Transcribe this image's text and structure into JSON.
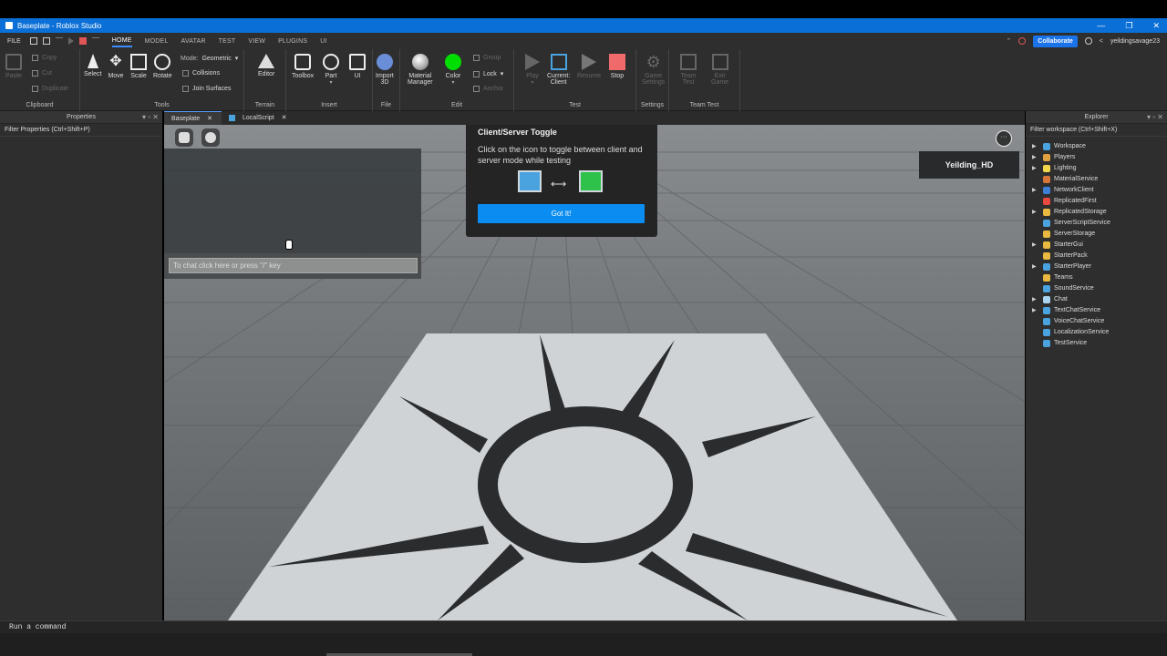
{
  "window": {
    "title": "Baseplate - Roblox Studio",
    "minimize": "—",
    "restore": "❐",
    "close": "✕"
  },
  "menubar": {
    "file": "FILE",
    "tabs": [
      "HOME",
      "MODEL",
      "AVATAR",
      "TEST",
      "VIEW",
      "PLUGINS",
      "UI"
    ],
    "active_tab": "HOME",
    "collaborate": "Collaborate",
    "username": "yeildingsavage23"
  },
  "ribbon": {
    "clipboard": {
      "label": "Clipboard",
      "paste": "Paste",
      "copy": "Copy",
      "cut": "Cut",
      "duplicate": "Duplicate"
    },
    "tools": {
      "label": "Tools",
      "select": "Select",
      "move": "Move",
      "scale": "Scale",
      "rotate": "Rotate",
      "mode_label": "Mode:",
      "mode_value": "Geometric",
      "collisions": "Collisions",
      "join_surfaces": "Join Surfaces"
    },
    "terrain": {
      "label": "Terrain",
      "editor": "Editor"
    },
    "insert": {
      "label": "Insert",
      "toolbox": "Toolbox",
      "part": "Part",
      "ui": "UI"
    },
    "file": {
      "label": "File",
      "import3d_1": "Import",
      "import3d_2": "3D"
    },
    "edit": {
      "label": "Edit",
      "material_1": "Material",
      "material_2": "Manager",
      "color": "Color",
      "group": "Group",
      "lock": "Lock",
      "anchor": "Anchor"
    },
    "test": {
      "label": "Test",
      "play": "Play",
      "current_1": "Current:",
      "current_2": "Client",
      "resume": "Resume",
      "stop": "Stop"
    },
    "settings": {
      "label": "Settings",
      "game_1": "Game",
      "game_2": "Settings"
    },
    "teamtest": {
      "label": "Team Test",
      "team_1": "Team",
      "team_2": "Test",
      "exit_1": "Exit",
      "exit_2": "Game"
    }
  },
  "properties": {
    "title": "Properties",
    "filter": "Filter Properties (Ctrl+Shift+P)"
  },
  "doc_tabs": [
    {
      "label": "Baseplate"
    },
    {
      "label": "LocalScript"
    }
  ],
  "viewport": {
    "chat_placeholder": "To chat click here or press \"/\" key",
    "player_name": "Yeilding_HD",
    "menu_glyph": "···"
  },
  "tooltip": {
    "title": "Client/Server Toggle",
    "description": "Click on the icon to toggle between client and server mode while testing",
    "button": "Got It!"
  },
  "explorer": {
    "title": "Explorer",
    "filter": "Filter workspace (Ctrl+Shift+X)",
    "items": [
      {
        "label": "Workspace",
        "expandable": true,
        "color": "#4aa3df"
      },
      {
        "label": "Players",
        "expandable": true,
        "color": "#e0a040"
      },
      {
        "label": "Lighting",
        "expandable": true,
        "color": "#f2d64b"
      },
      {
        "label": "MaterialService",
        "expandable": false,
        "color": "#d8763a"
      },
      {
        "label": "NetworkClient",
        "expandable": true,
        "color": "#3d7fd6"
      },
      {
        "label": "ReplicatedFirst",
        "expandable": false,
        "color": "#e8483e"
      },
      {
        "label": "ReplicatedStorage",
        "expandable": true,
        "color": "#e8b840"
      },
      {
        "label": "ServerScriptService",
        "expandable": false,
        "color": "#4aa3df"
      },
      {
        "label": "ServerStorage",
        "expandable": false,
        "color": "#e8b840"
      },
      {
        "label": "StarterGui",
        "expandable": true,
        "color": "#e8b840"
      },
      {
        "label": "StarterPack",
        "expandable": false,
        "color": "#e8b840"
      },
      {
        "label": "StarterPlayer",
        "expandable": true,
        "color": "#4aa3df"
      },
      {
        "label": "Teams",
        "expandable": false,
        "color": "#e8b840"
      },
      {
        "label": "SoundService",
        "expandable": false,
        "color": "#4aa3df"
      },
      {
        "label": "Chat",
        "expandable": true,
        "color": "#aad4f0"
      },
      {
        "label": "TextChatService",
        "expandable": true,
        "color": "#4aa3df"
      },
      {
        "label": "VoiceChatService",
        "expandable": false,
        "color": "#4aa3df"
      },
      {
        "label": "LocalizationService",
        "expandable": false,
        "color": "#4aa3df"
      },
      {
        "label": "TestService",
        "expandable": false,
        "color": "#4aa3df"
      }
    ]
  },
  "command_bar": {
    "placeholder": "Run a command"
  }
}
